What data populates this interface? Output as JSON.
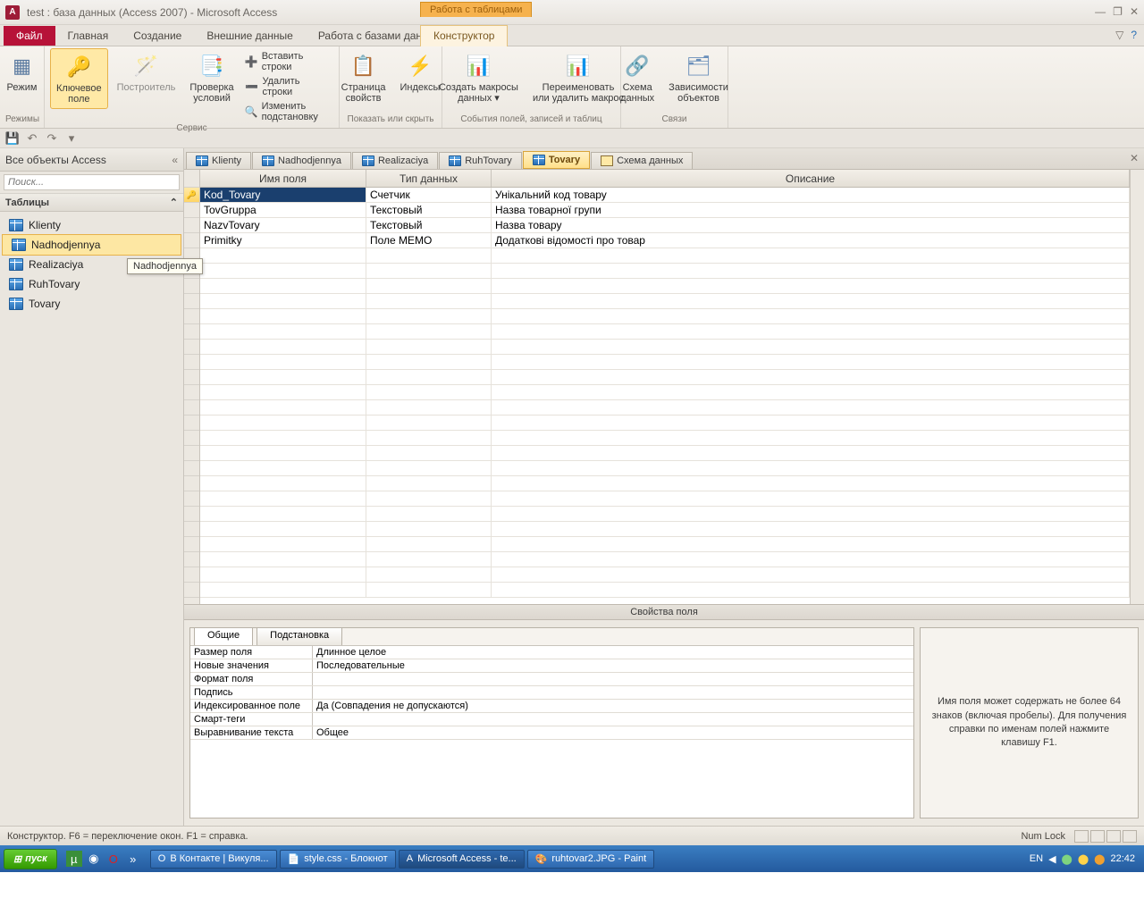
{
  "window": {
    "title": "test : база данных (Access 2007)  -  Microsoft Access",
    "context_tab": "Работа с таблицами"
  },
  "ribbon_tabs": {
    "file": "Файл",
    "home": "Главная",
    "create": "Создание",
    "external": "Внешние данные",
    "dbtools": "Работа с базами данных",
    "design": "Конструктор"
  },
  "ribbon": {
    "group_modes": {
      "mode": "Режим",
      "label": "Режимы"
    },
    "group_service": {
      "key": "Ключевое\nполе",
      "builder": "Построитель",
      "rules": "Проверка\nусловий",
      "insert_rows": "Вставить строки",
      "delete_rows": "Удалить строки",
      "modify_lookup": "Изменить подстановку",
      "label": "Сервис"
    },
    "group_show": {
      "prop_sheet": "Страница\nсвойств",
      "indexes": "Индексы",
      "label": "Показать или скрыть"
    },
    "group_events": {
      "create_macro": "Создать макросы\nданных ▾",
      "rename_macro": "Переименовать\nили удалить макрос",
      "label": "События полей, записей и таблиц"
    },
    "group_rel": {
      "schema": "Схема\nданных",
      "deps": "Зависимости\nобъектов",
      "label": "Связи"
    }
  },
  "nav": {
    "title": "Все объекты Access",
    "search_ph": "Поиск...",
    "section": "Таблицы",
    "items": [
      "Klienty",
      "Nadhodjennya",
      "Realizaciya",
      "RuhTovary",
      "Tovary"
    ],
    "tooltip": "Nadhodjennya"
  },
  "tabs": [
    "Klienty",
    "Nadhodjennya",
    "Realizaciya",
    "RuhTovary",
    "Tovary",
    "Схема данных"
  ],
  "active_tab": 4,
  "grid": {
    "headers": {
      "name": "Имя поля",
      "type": "Тип данных",
      "desc": "Описание"
    },
    "rows": [
      {
        "name": "Kod_Tovary",
        "type": "Счетчик",
        "desc": "Унікальний код товару",
        "pk": true,
        "sel": true
      },
      {
        "name": "TovGruppa",
        "type": "Текстовый",
        "desc": "Назва товарної групи"
      },
      {
        "name": "NazvTovary",
        "type": "Текстовый",
        "desc": "Назва товару"
      },
      {
        "name": "Primitky",
        "type": "Поле MEMO",
        "desc": "Додаткові відомості про товар"
      }
    ]
  },
  "props": {
    "title": "Свойства поля",
    "tabs": {
      "general": "Общие",
      "lookup": "Подстановка"
    },
    "rows": [
      {
        "label": "Размер поля",
        "val": "Длинное целое"
      },
      {
        "label": "Новые значения",
        "val": "Последовательные"
      },
      {
        "label": "Формат поля",
        "val": ""
      },
      {
        "label": "Подпись",
        "val": ""
      },
      {
        "label": "Индексированное поле",
        "val": "Да (Совпадения не допускаются)"
      },
      {
        "label": "Смарт-теги",
        "val": ""
      },
      {
        "label": "Выравнивание текста",
        "val": "Общее"
      }
    ],
    "help": "Имя поля может содержать не более 64 знаков (включая пробелы). Для получения справки по именам полей нажмите клавишу F1."
  },
  "status": {
    "left": "Конструктор.  F6 = переключение окон.  F1 = справка.",
    "numlock": "Num Lock"
  },
  "taskbar": {
    "start": "пуск",
    "tasks": [
      "В Контакте | Викуля...",
      "style.css - Блокнот",
      "Microsoft Access - te...",
      "ruhtovar2.JPG - Paint"
    ],
    "lang": "EN",
    "time": "22:42"
  }
}
